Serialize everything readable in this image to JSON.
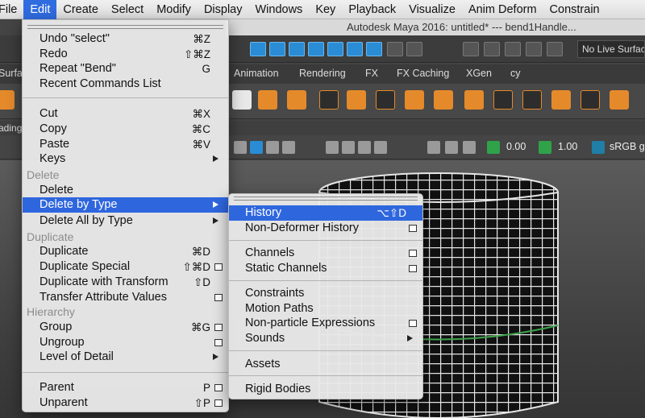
{
  "menubar": {
    "items": [
      "File",
      "Edit",
      "Create",
      "Select",
      "Modify",
      "Display",
      "Windows",
      "Key",
      "Playback",
      "Visualize",
      "Anim Deform",
      "Constrain"
    ]
  },
  "window": {
    "title": "Autodesk Maya 2016: untitled*   ---   bend1Handle..."
  },
  "statusline": {
    "live_surface": "No Live Surfac"
  },
  "shelf": {
    "tabs": [
      "Surfa",
      "Animation",
      "Rendering",
      "FX",
      "FX Caching",
      "XGen",
      "cy"
    ],
    "panel_label": "ading"
  },
  "panel_toolbar": {
    "value_a": "0.00",
    "value_b": "1.00",
    "color_space": "sRGB ga"
  },
  "colors": {
    "accent": "#2e66de",
    "menu_bg": "#e8e8e8",
    "maya_orange": "#e58a2a",
    "maya_blue": "#2a8cd4"
  },
  "edit_menu": {
    "items": [
      {
        "label": "Undo \"select\"",
        "shortcut": "⌘Z"
      },
      {
        "label": "Redo",
        "shortcut": "⇧⌘Z"
      },
      {
        "label": "Repeat \"Bend\"",
        "shortcut": "G"
      },
      {
        "label": "Recent Commands List",
        "shortcut": ""
      },
      {
        "label": "Cut",
        "shortcut": "⌘X"
      },
      {
        "label": "Copy",
        "shortcut": "⌘C"
      },
      {
        "label": "Paste",
        "shortcut": "⌘V"
      },
      {
        "label": "Keys",
        "shortcut": ""
      },
      {
        "label": "Delete",
        "shortcut": ""
      },
      {
        "label": "Delete by Type",
        "shortcut": ""
      },
      {
        "label": "Delete All by Type",
        "shortcut": ""
      },
      {
        "label": "Duplicate",
        "shortcut": "⌘D"
      },
      {
        "label": "Duplicate Special",
        "shortcut": "⇧⌘D"
      },
      {
        "label": "Duplicate with Transform",
        "shortcut": "⇧D"
      },
      {
        "label": "Transfer Attribute Values",
        "shortcut": ""
      },
      {
        "label": "Group",
        "shortcut": "⌘G"
      },
      {
        "label": "Ungroup",
        "shortcut": ""
      },
      {
        "label": "Level of Detail",
        "shortcut": ""
      },
      {
        "label": "Parent",
        "shortcut": "P"
      },
      {
        "label": "Unparent",
        "shortcut": "⇧P"
      }
    ],
    "sections": [
      "Delete",
      "Duplicate",
      "Hierarchy"
    ]
  },
  "submenu": {
    "items": [
      {
        "label": "History",
        "shortcut": "⌥⇧D"
      },
      {
        "label": "Non-Deformer History",
        "shortcut": ""
      },
      {
        "label": "Channels",
        "shortcut": ""
      },
      {
        "label": "Static Channels",
        "shortcut": ""
      },
      {
        "label": "Constraints",
        "shortcut": ""
      },
      {
        "label": "Motion Paths",
        "shortcut": ""
      },
      {
        "label": "Non-particle Expressions",
        "shortcut": ""
      },
      {
        "label": "Sounds",
        "shortcut": ""
      },
      {
        "label": "Assets",
        "shortcut": ""
      },
      {
        "label": "Rigid Bodies",
        "shortcut": ""
      }
    ]
  }
}
